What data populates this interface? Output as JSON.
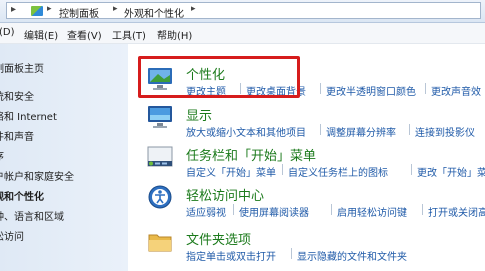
{
  "address_bar": {
    "crumbs": [
      "控制面板",
      "外观和个性化"
    ]
  },
  "menu": {
    "items": [
      "(D)",
      "编辑(E)",
      "查看(V)",
      "工具(T)",
      "帮助(H)"
    ]
  },
  "sidebar": {
    "items": [
      "制面板主页",
      "统和安全",
      "络和 Internet",
      "件和声音",
      "序",
      "户帐户和家庭安全",
      "观和个性化",
      "钟、语言和区域",
      "松访问"
    ],
    "active_index": 6
  },
  "categories": [
    {
      "title": "个性化",
      "icon": "personalization-icon",
      "links": [
        "更改主题",
        "更改桌面背景",
        "更改半透明窗口颜色",
        "更改声音效"
      ]
    },
    {
      "title": "显示",
      "icon": "display-icon",
      "links": [
        "放大或缩小文本和其他项目",
        "调整屏幕分辨率",
        "连接到投影仪"
      ]
    },
    {
      "title": "任务栏和「开始」菜单",
      "icon": "taskbar-icon",
      "links": [
        "自定义「开始」菜单",
        "自定义任务栏上的图标",
        "更改「开始」菜单"
      ]
    },
    {
      "title": "轻松访问中心",
      "icon": "ease-of-access-icon",
      "links": [
        "适应弱视",
        "使用屏幕阅读器",
        "启用轻松访问键",
        "打开或关闭高"
      ]
    },
    {
      "title": "文件夹选项",
      "icon": "folder-options-icon",
      "links": [
        "指定单击或双击打开",
        "显示隐藏的文件和文件夹"
      ]
    }
  ],
  "colors": {
    "highlight": "#d61c1c",
    "title_green": "#1b7a1b",
    "link_blue": "#1f5aa8"
  }
}
